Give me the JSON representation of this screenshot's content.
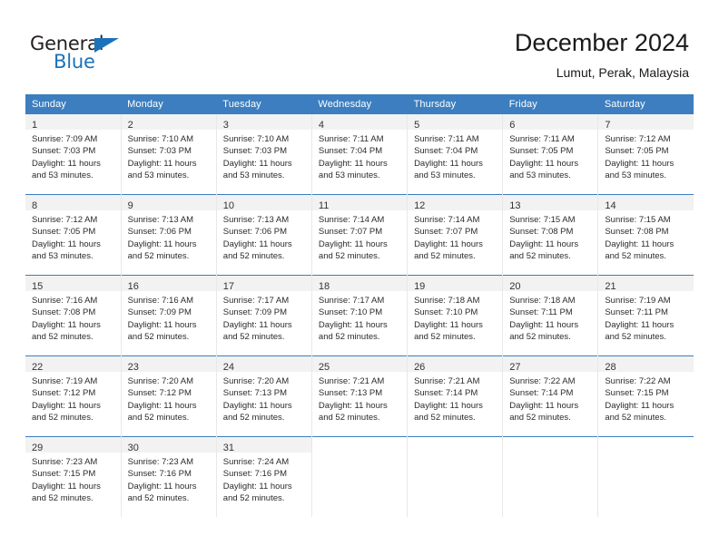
{
  "brand": {
    "name_part1": "General",
    "name_part2": "Blue",
    "accent_color": "#1b72bb"
  },
  "header": {
    "title": "December 2024",
    "subtitle": "Lumut, Perak, Malaysia"
  },
  "calendar": {
    "header_bg": "#3c7ebf",
    "daynum_bg": "#f2f2f2",
    "weekdays": [
      "Sunday",
      "Monday",
      "Tuesday",
      "Wednesday",
      "Thursday",
      "Friday",
      "Saturday"
    ],
    "weeks": [
      [
        {
          "day": "1",
          "sunrise": "Sunrise: 7:09 AM",
          "sunset": "Sunset: 7:03 PM",
          "daylight1": "Daylight: 11 hours",
          "daylight2": "and 53 minutes."
        },
        {
          "day": "2",
          "sunrise": "Sunrise: 7:10 AM",
          "sunset": "Sunset: 7:03 PM",
          "daylight1": "Daylight: 11 hours",
          "daylight2": "and 53 minutes."
        },
        {
          "day": "3",
          "sunrise": "Sunrise: 7:10 AM",
          "sunset": "Sunset: 7:03 PM",
          "daylight1": "Daylight: 11 hours",
          "daylight2": "and 53 minutes."
        },
        {
          "day": "4",
          "sunrise": "Sunrise: 7:11 AM",
          "sunset": "Sunset: 7:04 PM",
          "daylight1": "Daylight: 11 hours",
          "daylight2": "and 53 minutes."
        },
        {
          "day": "5",
          "sunrise": "Sunrise: 7:11 AM",
          "sunset": "Sunset: 7:04 PM",
          "daylight1": "Daylight: 11 hours",
          "daylight2": "and 53 minutes."
        },
        {
          "day": "6",
          "sunrise": "Sunrise: 7:11 AM",
          "sunset": "Sunset: 7:05 PM",
          "daylight1": "Daylight: 11 hours",
          "daylight2": "and 53 minutes."
        },
        {
          "day": "7",
          "sunrise": "Sunrise: 7:12 AM",
          "sunset": "Sunset: 7:05 PM",
          "daylight1": "Daylight: 11 hours",
          "daylight2": "and 53 minutes."
        }
      ],
      [
        {
          "day": "8",
          "sunrise": "Sunrise: 7:12 AM",
          "sunset": "Sunset: 7:05 PM",
          "daylight1": "Daylight: 11 hours",
          "daylight2": "and 53 minutes."
        },
        {
          "day": "9",
          "sunrise": "Sunrise: 7:13 AM",
          "sunset": "Sunset: 7:06 PM",
          "daylight1": "Daylight: 11 hours",
          "daylight2": "and 52 minutes."
        },
        {
          "day": "10",
          "sunrise": "Sunrise: 7:13 AM",
          "sunset": "Sunset: 7:06 PM",
          "daylight1": "Daylight: 11 hours",
          "daylight2": "and 52 minutes."
        },
        {
          "day": "11",
          "sunrise": "Sunrise: 7:14 AM",
          "sunset": "Sunset: 7:07 PM",
          "daylight1": "Daylight: 11 hours",
          "daylight2": "and 52 minutes."
        },
        {
          "day": "12",
          "sunrise": "Sunrise: 7:14 AM",
          "sunset": "Sunset: 7:07 PM",
          "daylight1": "Daylight: 11 hours",
          "daylight2": "and 52 minutes."
        },
        {
          "day": "13",
          "sunrise": "Sunrise: 7:15 AM",
          "sunset": "Sunset: 7:08 PM",
          "daylight1": "Daylight: 11 hours",
          "daylight2": "and 52 minutes."
        },
        {
          "day": "14",
          "sunrise": "Sunrise: 7:15 AM",
          "sunset": "Sunset: 7:08 PM",
          "daylight1": "Daylight: 11 hours",
          "daylight2": "and 52 minutes."
        }
      ],
      [
        {
          "day": "15",
          "sunrise": "Sunrise: 7:16 AM",
          "sunset": "Sunset: 7:08 PM",
          "daylight1": "Daylight: 11 hours",
          "daylight2": "and 52 minutes."
        },
        {
          "day": "16",
          "sunrise": "Sunrise: 7:16 AM",
          "sunset": "Sunset: 7:09 PM",
          "daylight1": "Daylight: 11 hours",
          "daylight2": "and 52 minutes."
        },
        {
          "day": "17",
          "sunrise": "Sunrise: 7:17 AM",
          "sunset": "Sunset: 7:09 PM",
          "daylight1": "Daylight: 11 hours",
          "daylight2": "and 52 minutes."
        },
        {
          "day": "18",
          "sunrise": "Sunrise: 7:17 AM",
          "sunset": "Sunset: 7:10 PM",
          "daylight1": "Daylight: 11 hours",
          "daylight2": "and 52 minutes."
        },
        {
          "day": "19",
          "sunrise": "Sunrise: 7:18 AM",
          "sunset": "Sunset: 7:10 PM",
          "daylight1": "Daylight: 11 hours",
          "daylight2": "and 52 minutes."
        },
        {
          "day": "20",
          "sunrise": "Sunrise: 7:18 AM",
          "sunset": "Sunset: 7:11 PM",
          "daylight1": "Daylight: 11 hours",
          "daylight2": "and 52 minutes."
        },
        {
          "day": "21",
          "sunrise": "Sunrise: 7:19 AM",
          "sunset": "Sunset: 7:11 PM",
          "daylight1": "Daylight: 11 hours",
          "daylight2": "and 52 minutes."
        }
      ],
      [
        {
          "day": "22",
          "sunrise": "Sunrise: 7:19 AM",
          "sunset": "Sunset: 7:12 PM",
          "daylight1": "Daylight: 11 hours",
          "daylight2": "and 52 minutes."
        },
        {
          "day": "23",
          "sunrise": "Sunrise: 7:20 AM",
          "sunset": "Sunset: 7:12 PM",
          "daylight1": "Daylight: 11 hours",
          "daylight2": "and 52 minutes."
        },
        {
          "day": "24",
          "sunrise": "Sunrise: 7:20 AM",
          "sunset": "Sunset: 7:13 PM",
          "daylight1": "Daylight: 11 hours",
          "daylight2": "and 52 minutes."
        },
        {
          "day": "25",
          "sunrise": "Sunrise: 7:21 AM",
          "sunset": "Sunset: 7:13 PM",
          "daylight1": "Daylight: 11 hours",
          "daylight2": "and 52 minutes."
        },
        {
          "day": "26",
          "sunrise": "Sunrise: 7:21 AM",
          "sunset": "Sunset: 7:14 PM",
          "daylight1": "Daylight: 11 hours",
          "daylight2": "and 52 minutes."
        },
        {
          "day": "27",
          "sunrise": "Sunrise: 7:22 AM",
          "sunset": "Sunset: 7:14 PM",
          "daylight1": "Daylight: 11 hours",
          "daylight2": "and 52 minutes."
        },
        {
          "day": "28",
          "sunrise": "Sunrise: 7:22 AM",
          "sunset": "Sunset: 7:15 PM",
          "daylight1": "Daylight: 11 hours",
          "daylight2": "and 52 minutes."
        }
      ],
      [
        {
          "day": "29",
          "sunrise": "Sunrise: 7:23 AM",
          "sunset": "Sunset: 7:15 PM",
          "daylight1": "Daylight: 11 hours",
          "daylight2": "and 52 minutes."
        },
        {
          "day": "30",
          "sunrise": "Sunrise: 7:23 AM",
          "sunset": "Sunset: 7:16 PM",
          "daylight1": "Daylight: 11 hours",
          "daylight2": "and 52 minutes."
        },
        {
          "day": "31",
          "sunrise": "Sunrise: 7:24 AM",
          "sunset": "Sunset: 7:16 PM",
          "daylight1": "Daylight: 11 hours",
          "daylight2": "and 52 minutes."
        },
        {
          "day": "",
          "sunrise": "",
          "sunset": "",
          "daylight1": "",
          "daylight2": ""
        },
        {
          "day": "",
          "sunrise": "",
          "sunset": "",
          "daylight1": "",
          "daylight2": ""
        },
        {
          "day": "",
          "sunrise": "",
          "sunset": "",
          "daylight1": "",
          "daylight2": ""
        },
        {
          "day": "",
          "sunrise": "",
          "sunset": "",
          "daylight1": "",
          "daylight2": ""
        }
      ]
    ]
  }
}
